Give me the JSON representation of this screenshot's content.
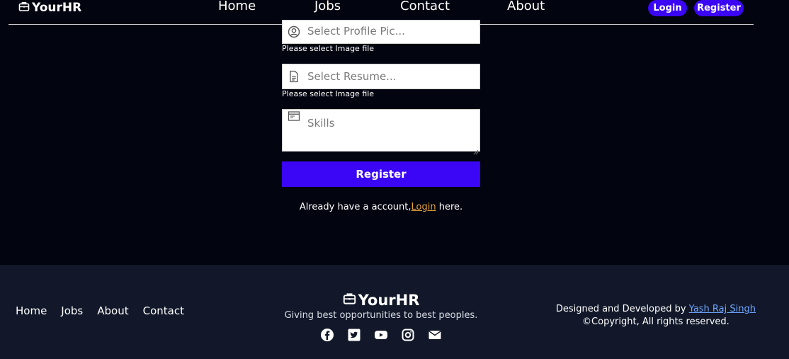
{
  "navbar": {
    "brand": "YourHR",
    "links": [
      "Home",
      "Jobs",
      "Contact",
      "About"
    ],
    "login": "Login",
    "register": "Register"
  },
  "form": {
    "profile_placeholder": "Select Profile Pic...",
    "profile_hint": "Please select Image file",
    "resume_placeholder": "Select Resume...",
    "resume_hint": "Please select Image file",
    "skills_placeholder": "Skills",
    "submit": "Register",
    "already_prefix": "Already have a account,",
    "already_link": "Login",
    "already_suffix": " here."
  },
  "footer": {
    "links": [
      "Home",
      "Jobs",
      "About",
      "Contact"
    ],
    "brand": "YourHR",
    "tagline": "Giving best opportunities to best peoples.",
    "designed_prefix": "Designed and Developed by ",
    "designer": "Yash Raj Singh",
    "copyright": "©Copyright, All rights reserved.",
    "socials": [
      "facebook-icon",
      "twitter-icon",
      "youtube-icon",
      "instagram-icon",
      "mail-icon"
    ]
  },
  "colors": {
    "background": "#02040f",
    "footer_bg": "#121829",
    "accent": "#3a06f5",
    "login_link": "#e8a33a",
    "designer_link": "#6fa6ff"
  }
}
